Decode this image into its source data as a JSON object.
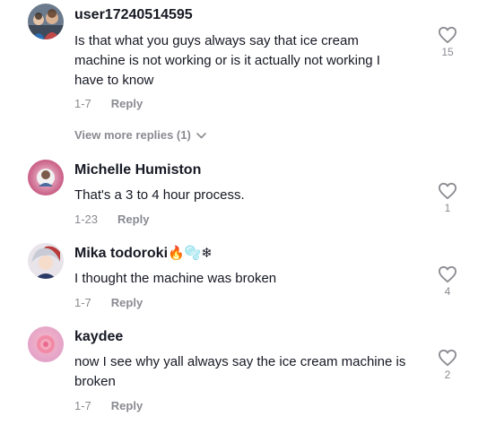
{
  "comments": [
    {
      "username": "user17240514595",
      "text": "Is that what you guys always say that ice cream machine is not working or is it actually not working I have to know",
      "date": "1-7",
      "reply_label": "Reply",
      "likes": "15",
      "avatar_icon": "profile-photo-group"
    },
    {
      "username": "Michelle Humiston",
      "text": "That's a 3 to 4 hour process.",
      "date": "1-23",
      "reply_label": "Reply",
      "likes": "1",
      "avatar_icon": "profile-photo"
    },
    {
      "username": "Mika todoroki",
      "username_emoji": "🔥🫧❄",
      "text": "I thought the machine was broken",
      "date": "1-7",
      "reply_label": "Reply",
      "likes": "4",
      "avatar_icon": "profile-photo-anime"
    },
    {
      "username": "kaydee",
      "text": "now I see why yall always say the ice cream machine is broken",
      "date": "1-7",
      "reply_label": "Reply",
      "likes": "2",
      "avatar_icon": "profile-photo-rose"
    }
  ],
  "view_more_replies": "View more replies (1)",
  "colors": {
    "text_primary": "#161823",
    "text_secondary": "#8a8b91",
    "background": "#ffffff"
  }
}
